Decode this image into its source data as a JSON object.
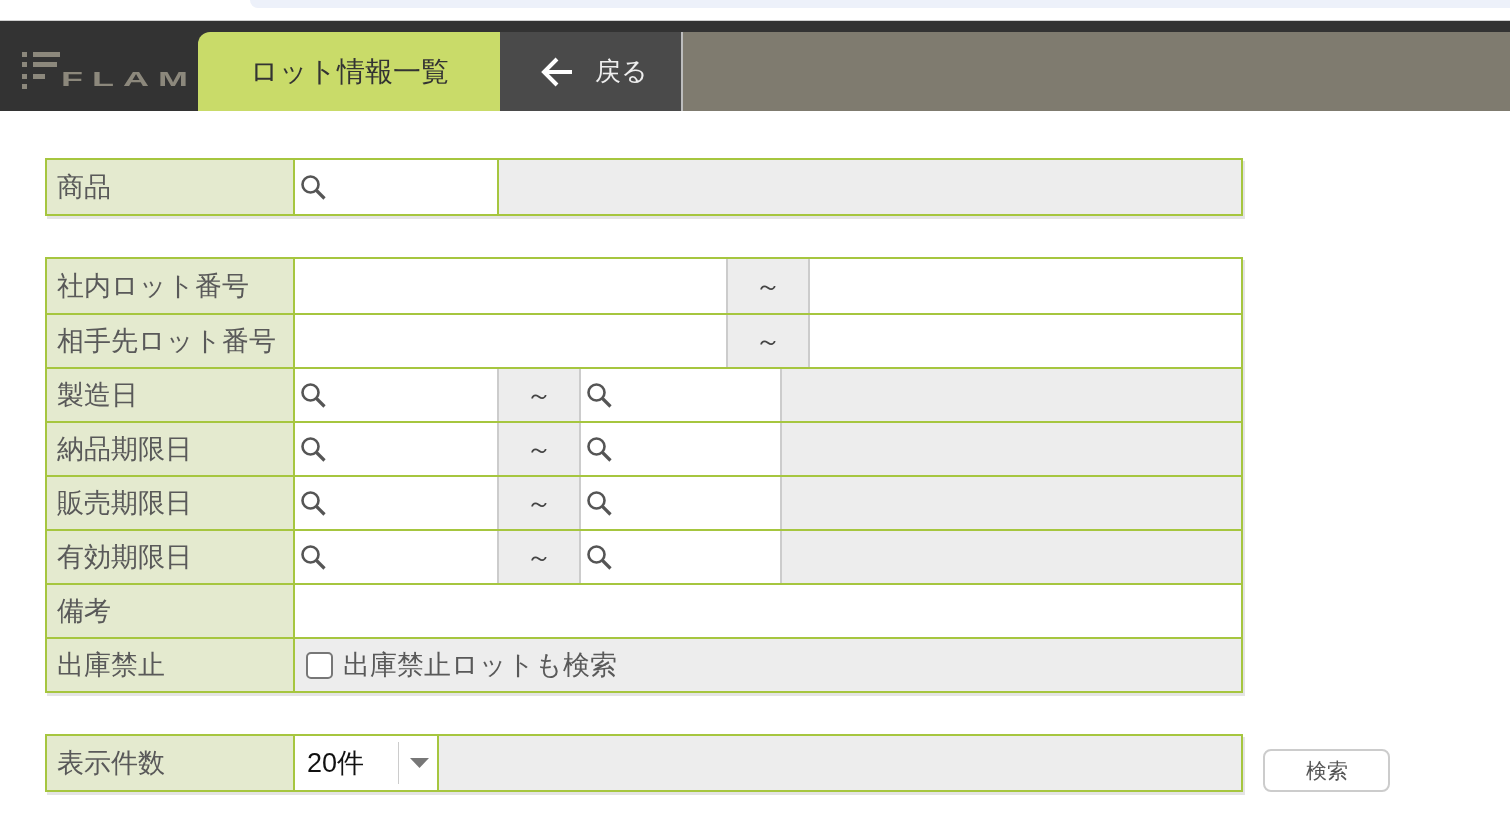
{
  "header": {
    "logo": "FLAM",
    "tabs": [
      {
        "label": "ロット情報一覧",
        "selected": true
      }
    ],
    "back_link": {
      "label": "戻る"
    }
  },
  "sections": [
    {
      "rows": [
        {
          "kind": "lookup",
          "label": "商品"
        }
      ]
    },
    {
      "rows": [
        {
          "kind": "text_range",
          "label": "社内ロット番号",
          "separator": "～"
        },
        {
          "kind": "text_range",
          "label": "相手先ロット番号",
          "separator": "～"
        },
        {
          "kind": "lookup_range",
          "label": "製造日",
          "separator": "～"
        },
        {
          "kind": "lookup_range",
          "label": "納品期限日",
          "separator": "～"
        },
        {
          "kind": "lookup_range",
          "label": "販売期限日",
          "separator": "～"
        },
        {
          "kind": "lookup_range",
          "label": "有効期限日",
          "separator": "～"
        },
        {
          "kind": "text",
          "label": "備考"
        },
        {
          "kind": "checkbox",
          "label": "出庫禁止",
          "option": {
            "label": "出庫禁止ロットも検索",
            "checked": false
          }
        }
      ]
    },
    {
      "rows": [
        {
          "kind": "select",
          "label": "表示件数",
          "value": "20件"
        }
      ]
    }
  ],
  "search_button": {
    "label": "検索"
  }
}
